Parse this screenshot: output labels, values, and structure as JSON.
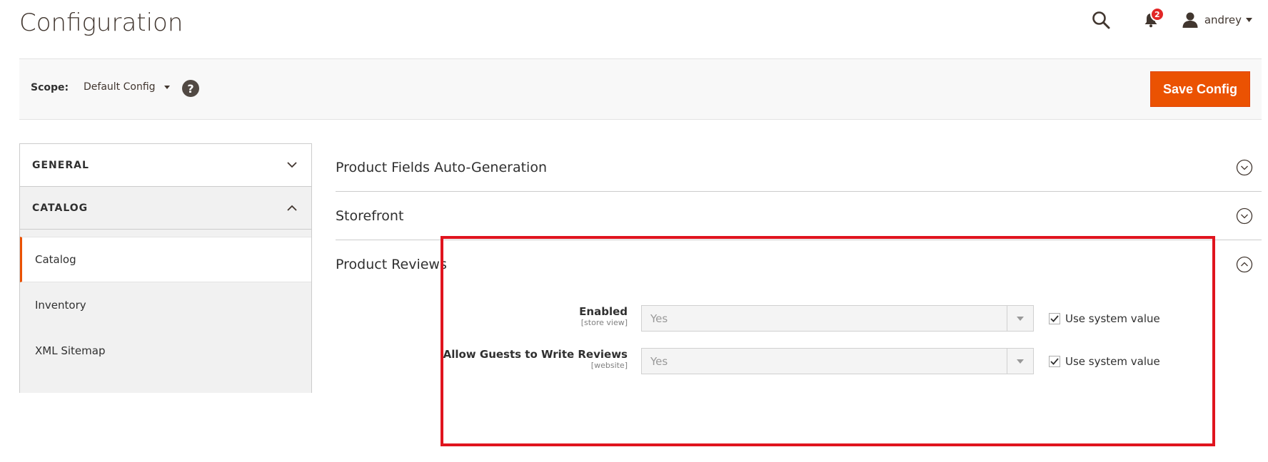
{
  "page": {
    "title": "Configuration"
  },
  "header": {
    "notifications_count": "2",
    "user_name": "andrey"
  },
  "action_bar": {
    "scope_label": "Scope:",
    "scope_value": "Default Config",
    "help_symbol": "?",
    "save_label": "Save Config"
  },
  "sidebar": {
    "groups": [
      {
        "label": "GENERAL",
        "expanded": false
      },
      {
        "label": "CATALOG",
        "expanded": true
      }
    ],
    "items": [
      {
        "label": "Catalog",
        "active": true
      },
      {
        "label": "Inventory",
        "active": false
      },
      {
        "label": "XML Sitemap",
        "active": false
      }
    ]
  },
  "sections": [
    {
      "title": "Product Fields Auto-Generation",
      "expanded": false
    },
    {
      "title": "Storefront",
      "expanded": false
    },
    {
      "title": "Product Reviews",
      "expanded": true
    }
  ],
  "fields": [
    {
      "label": "Enabled",
      "scope": "[store view]",
      "value": "Yes",
      "checkbox_label": "Use system value",
      "checked": true
    },
    {
      "label": "Allow Guests to Write Reviews",
      "scope": "[website]",
      "value": "Yes",
      "checkbox_label": "Use system value",
      "checked": true
    }
  ],
  "colors": {
    "accent": "#eb5202",
    "badge": "#e22626",
    "highlight": "#e0141e"
  }
}
